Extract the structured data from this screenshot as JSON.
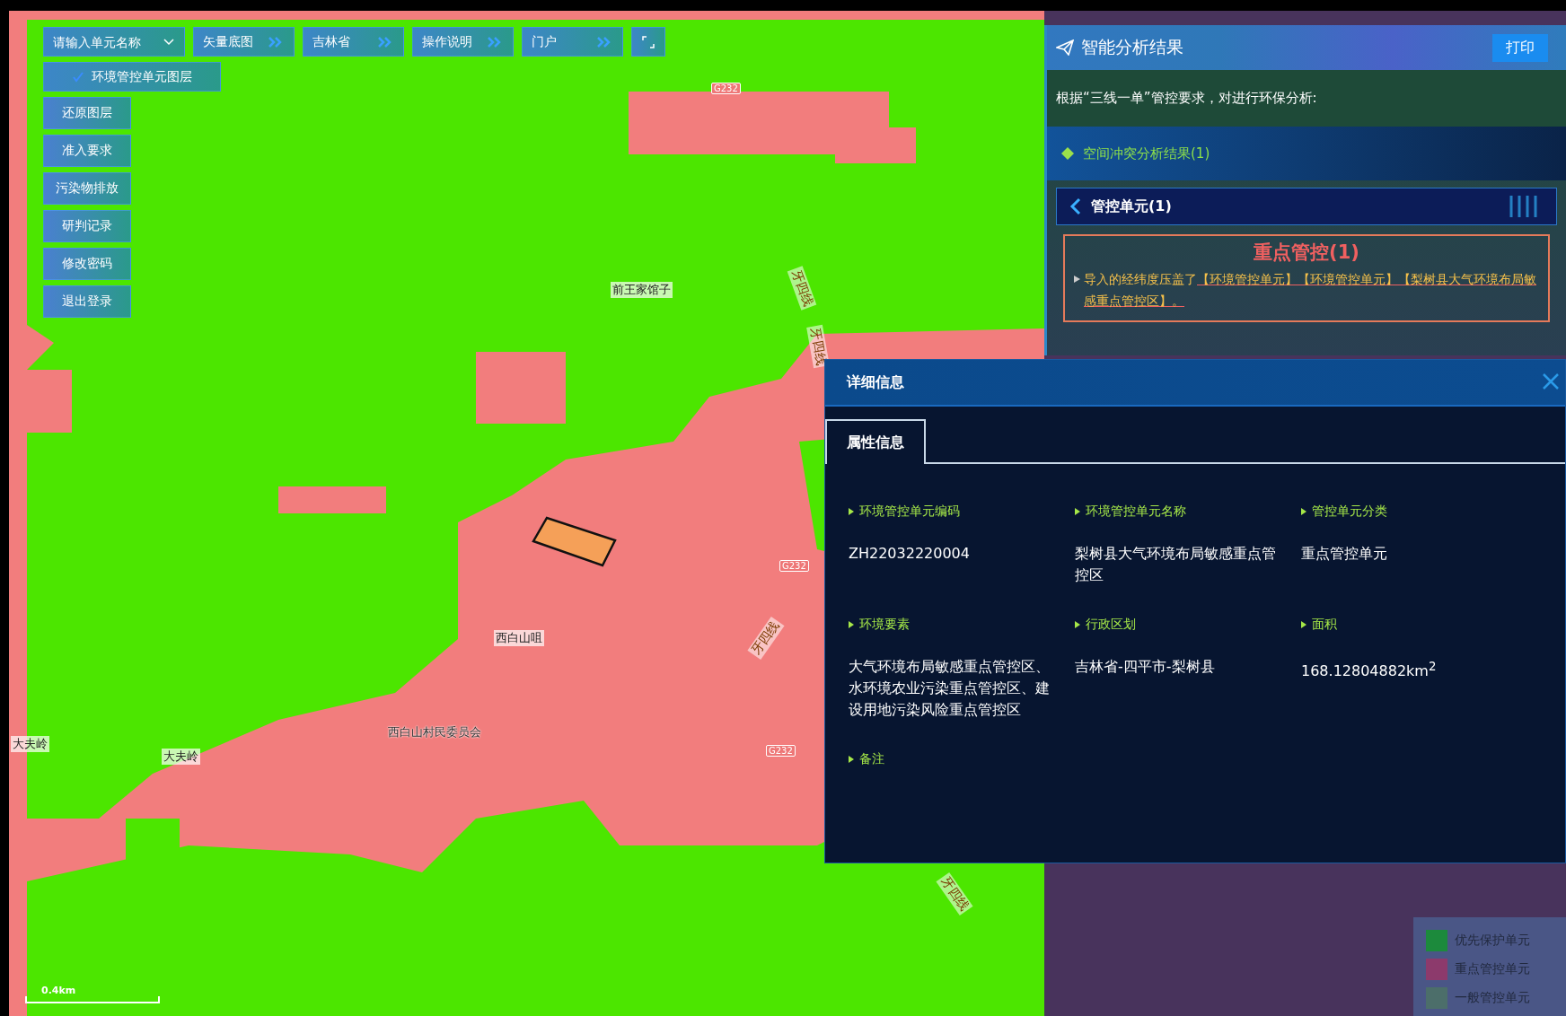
{
  "toolbar": {
    "unit_select": {
      "placeholder": "请输入单元名称"
    },
    "buttons": [
      {
        "label": "矢量底图"
      },
      {
        "label": "吉林省"
      },
      {
        "label": "操作说明"
      },
      {
        "label": "门户"
      }
    ]
  },
  "layer_toggle": {
    "label": "环境管控单元图层",
    "checked": true
  },
  "side_buttons": [
    "还原图层",
    "准入要求",
    "污染物排放",
    "研判记录",
    "修改密码",
    "退出登录"
  ],
  "map": {
    "labels": [
      {
        "kind": "place",
        "text": "前王家馆子"
      },
      {
        "kind": "place",
        "text": "西白山咀"
      },
      {
        "kind": "poi",
        "text": "西白山村民委员会"
      },
      {
        "kind": "place",
        "text": "大夫岭"
      },
      {
        "kind": "place",
        "text": "大夫岭"
      },
      {
        "kind": "shield",
        "text": "G232"
      },
      {
        "kind": "shield",
        "text": "G232"
      },
      {
        "kind": "shield",
        "text": "G232"
      },
      {
        "kind": "road",
        "text": "牙四线"
      },
      {
        "kind": "road",
        "text": "牙四线"
      },
      {
        "kind": "road",
        "text": "牙四线"
      },
      {
        "kind": "road",
        "text": "牙四线"
      }
    ],
    "scale": "0.4km"
  },
  "analysis": {
    "title": "智能分析结果",
    "print_button": "打印",
    "intro": "根据“三线一单”管控要求，对进行环保分析:",
    "section": "空间冲突分析结果(1)",
    "group": {
      "label": "管控单元(1)",
      "expanded": true
    },
    "result": {
      "title": "重点管控(1)",
      "text": "导入的经纬度压盖了",
      "linked_units": "【环境管控单元】【环境管控单元】【梨树县大气环境布局敏感重点管控区】。"
    }
  },
  "detail": {
    "title": "详细信息",
    "tabs": [
      {
        "label": "属性信息",
        "selected": true
      }
    ],
    "fields": [
      {
        "label": "环境管控单元编码",
        "value": "ZH22032220004"
      },
      {
        "label": "环境管控单元名称",
        "value": "梨树县大气环境布局敏感重点管控区"
      },
      {
        "label": "管控单元分类",
        "value": "重点管控单元"
      },
      {
        "label": "环境要素",
        "value": "大气环境布局敏感重点管控区、水环境农业污染重点管控区、建设用地污染风险重点管控区"
      },
      {
        "label": "行政区划",
        "value": "吉林省-四平市-梨树县"
      },
      {
        "label": "面积",
        "value": "168.12804882km$^{2}$"
      },
      {
        "label": "备注"
      }
    ]
  },
  "legend": [
    {
      "label": "优先保护单元",
      "color": "#1c8a3c"
    },
    {
      "label": "重点管控单元",
      "color": "#8c3a6c"
    },
    {
      "label": "一般管控单元",
      "color": "#4c6e6a"
    }
  ]
}
